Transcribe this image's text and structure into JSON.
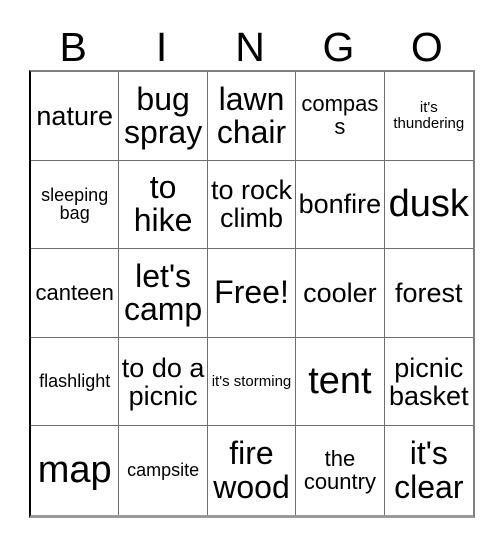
{
  "card": {
    "title": "Bingo Card",
    "header_letters": [
      "B",
      "I",
      "N",
      "G",
      "O"
    ],
    "columns": 5,
    "rows": 5,
    "free_space_label": "Free!",
    "free_space_position": {
      "row": 3,
      "column": 3
    },
    "background_color": "#ffffff",
    "text_color": "#000000",
    "grid_line_color": "#6e6e6e",
    "cells": [
      [
        {
          "text": "nature",
          "size": "md"
        },
        {
          "text": "bug spray",
          "size": "lg"
        },
        {
          "text": "lawn chair",
          "size": "lg"
        },
        {
          "text": "compass",
          "size": "sm"
        },
        {
          "text": "it's thundering",
          "size": "xxs"
        }
      ],
      [
        {
          "text": "sleeping bag",
          "size": "xs"
        },
        {
          "text": "to hike",
          "size": "lg"
        },
        {
          "text": "to rock climb",
          "size": "md"
        },
        {
          "text": "bonfire",
          "size": "md"
        },
        {
          "text": "dusk",
          "size": "xl"
        }
      ],
      [
        {
          "text": "canteen",
          "size": "sm"
        },
        {
          "text": "let's camp",
          "size": "lg"
        },
        {
          "text": "Free!",
          "size": "lg"
        },
        {
          "text": "cooler",
          "size": "md"
        },
        {
          "text": "forest",
          "size": "md"
        }
      ],
      [
        {
          "text": "flashlight",
          "size": "xs"
        },
        {
          "text": "to do a picnic",
          "size": "md"
        },
        {
          "text": "it's storming",
          "size": "xxs"
        },
        {
          "text": "tent",
          "size": "xl"
        },
        {
          "text": "picnic basket",
          "size": "md"
        }
      ],
      [
        {
          "text": "map",
          "size": "xl"
        },
        {
          "text": "campsite",
          "size": "xs"
        },
        {
          "text": "fire wood",
          "size": "lg"
        },
        {
          "text": "the country",
          "size": "sm"
        },
        {
          "text": "it's clear",
          "size": "lg"
        }
      ]
    ]
  }
}
